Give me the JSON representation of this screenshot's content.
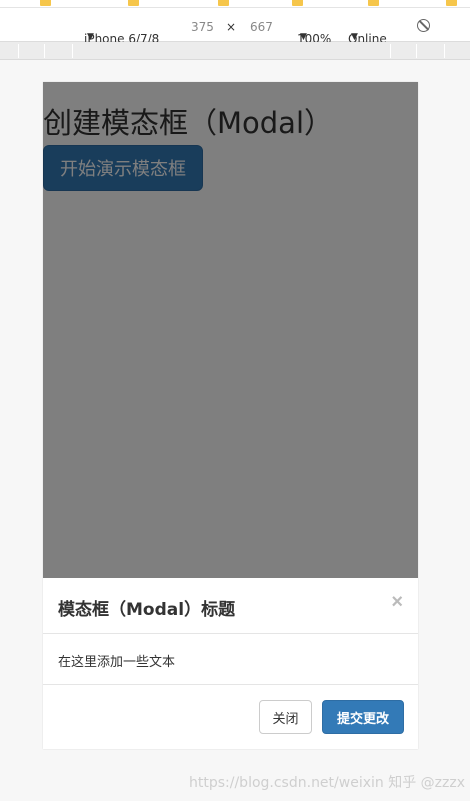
{
  "devtools": {
    "device": "iPhone 6/7/8",
    "width": "375",
    "times": "×",
    "height": "667",
    "zoom": "100%",
    "network": "Online"
  },
  "page": {
    "title": "创建模态框（Modal）",
    "demo_button": "开始演示模态框"
  },
  "modal": {
    "title": "模态框（Modal）标题",
    "close_symbol": "×",
    "body": "在这里添加一些文本",
    "close_button": "关闭",
    "submit_button": "提交更改"
  },
  "watermark": "https://blog.csdn.net/weixin 知乎 @zzzx",
  "colors": {
    "primary": "#337ab7",
    "backdrop": "rgba(0,0,0,0.5)"
  }
}
